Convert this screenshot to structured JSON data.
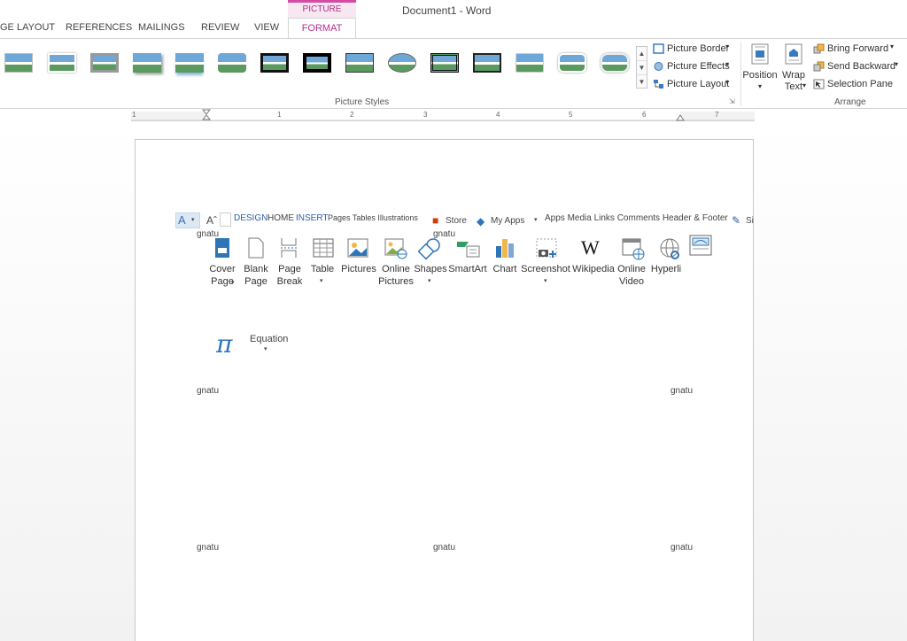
{
  "window": {
    "title": "Document1 - Word"
  },
  "tabs": [
    "GE LAYOUT",
    "REFERENCES",
    "MAILINGS",
    "REVIEW",
    "VIEW"
  ],
  "contextual_tab": {
    "header": "PICTURE TOOLS",
    "tab": "FORMAT"
  },
  "picture_styles": {
    "group_label": "Picture Styles",
    "count": 14
  },
  "style_commands": {
    "border": "Picture Border",
    "effects": "Picture Effects",
    "layout": "Picture Layout"
  },
  "arrange": {
    "group_label": "Arrange",
    "position": "Position",
    "wrap_1": "Wrap",
    "wrap_2": "Text",
    "bring_forward": "Bring Forward",
    "send_backward": "Send Backward",
    "selection_pane": "Selection Pane"
  },
  "ruler": {
    "numbers": [
      "1",
      "1",
      "2",
      "3",
      "4",
      "5",
      "6",
      "7"
    ]
  },
  "embedded": {
    "toolbar": {
      "design": "DESIGN",
      "home": "HOME",
      "insert": "INSERT",
      "groups": "Pages Tables Illustrations",
      "store": "Store",
      "myapps": "My Apps",
      "apps_row": "Apps Media Links Comments Header & Footer",
      "sign": "Si"
    },
    "fragment": "gnatu",
    "buttons": {
      "cover_1": "Cover",
      "cover_2": "Page",
      "blank_1": "Blank",
      "blank_2": "Page",
      "break_1": "Page",
      "break_2": "Break",
      "table": "Table",
      "pictures": "Pictures",
      "online_1": "Online",
      "online_2": "Pictures",
      "shapes": "Shapes",
      "smartart": "SmartArt",
      "chart": "Chart",
      "screenshot": "Screenshot",
      "wikipedia": "Wikipedia",
      "video_1": "Online",
      "video_2": "Video",
      "hyperlink": "Hyperli"
    },
    "equation": "Equation"
  }
}
